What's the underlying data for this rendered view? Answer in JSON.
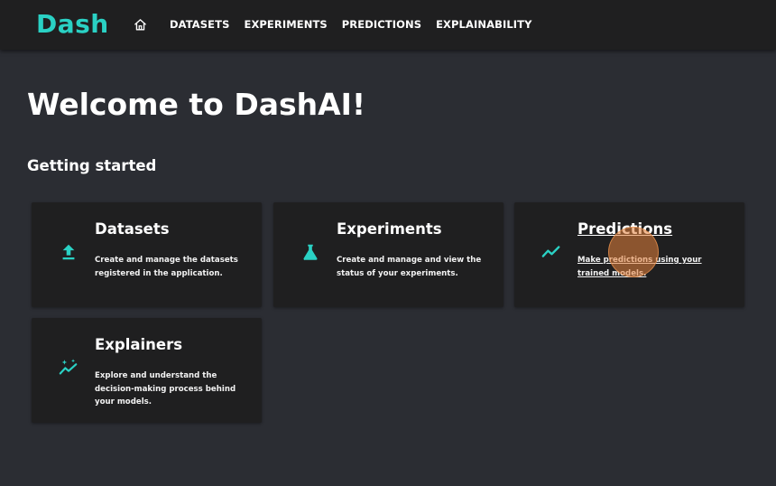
{
  "app": {
    "logo_text": "Dash"
  },
  "nav": {
    "home_icon": "home-icon",
    "items": [
      {
        "label": "DATASETS"
      },
      {
        "label": "EXPERIMENTS"
      },
      {
        "label": "PREDICTIONS"
      },
      {
        "label": "EXPLAINABILITY"
      }
    ]
  },
  "main": {
    "title": "Welcome to DashAI!",
    "subtitle": "Getting started",
    "cards": [
      {
        "title": "Datasets",
        "description": "Create and manage the datasets registered in the application.",
        "icon": "upload-icon"
      },
      {
        "title": "Experiments",
        "description": "Create and manage and view the status of your experiments.",
        "icon": "flask-icon"
      },
      {
        "title": "Predictions",
        "description": "Make predictions using your trained models.",
        "icon": "trending-line-icon"
      },
      {
        "title": "Explainers",
        "description": "Explore and understand the decision-making process behind your models.",
        "icon": "sparkle-trend-icon"
      }
    ]
  },
  "colors": {
    "accent": "#2ad1c4",
    "background": "#2b2d33",
    "surface": "#1f1f20"
  }
}
